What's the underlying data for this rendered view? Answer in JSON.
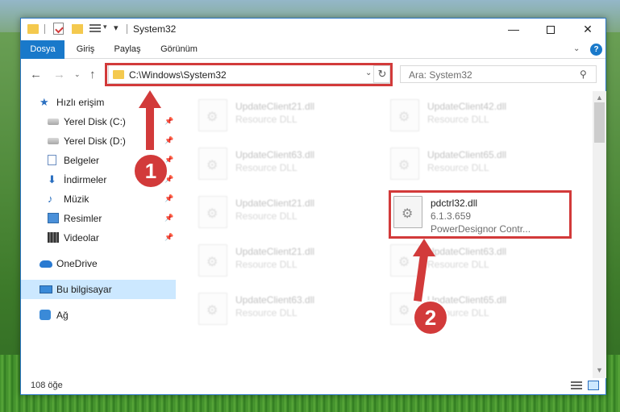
{
  "window": {
    "title": "System32",
    "minimize_glyph": "—",
    "close_glyph": "✕"
  },
  "ribbon": {
    "tabs": [
      "Dosya",
      "Giriş",
      "Paylaş",
      "Görünüm"
    ],
    "help": "?",
    "expand_glyph": "⌄"
  },
  "nav": {
    "back": "←",
    "forward": "→",
    "recent": "⌄",
    "up": "↑",
    "address": "C:\\Windows\\System32",
    "address_chevron": "⌄",
    "refresh": "↻",
    "search_placeholder": "Ara: System32",
    "search_glyph": "⚲"
  },
  "sidebar": {
    "items": [
      {
        "label": "Hızlı erişim",
        "icon": "star-icon",
        "glyph": "★"
      },
      {
        "label": "Yerel Disk (C:)",
        "icon": "disk-icon",
        "pinned": true
      },
      {
        "label": "Yerel Disk (D:)",
        "icon": "disk-icon",
        "pinned": true
      },
      {
        "label": "Belgeler",
        "icon": "document-icon",
        "pinned": true
      },
      {
        "label": "İndirmeler",
        "icon": "download-icon",
        "glyph": "⬇",
        "pinned": true
      },
      {
        "label": "Müzik",
        "icon": "music-icon",
        "glyph": "♪",
        "pinned": true
      },
      {
        "label": "Resimler",
        "icon": "picture-icon",
        "pinned": true
      },
      {
        "label": "Videolar",
        "icon": "video-icon",
        "pinned": true
      },
      {
        "label": "OneDrive",
        "icon": "cloud-icon"
      },
      {
        "label": "Bu bilgisayar",
        "icon": "computer-icon",
        "selected": true
      },
      {
        "label": "Ağ",
        "icon": "network-icon"
      }
    ],
    "pin_glyph": "📌"
  },
  "files": [
    {
      "name": "UpdateClient21.dll",
      "desc": "Resource DLL"
    },
    {
      "name": "UpdateClient42.dll",
      "desc": "Resource DLL"
    },
    {
      "name": "UpdateClient63.dll",
      "desc": "Resource DLL"
    },
    {
      "name": "UpdateClient65.dll",
      "desc": "Resource DLL"
    },
    {
      "name": "UpdateClient21.dll",
      "desc": "Resource DLL"
    },
    {
      "name": "pdctrl32.dll",
      "version": "6.1.3.659",
      "desc": "PowerDesignor Contr..."
    },
    {
      "name": "UpdateClient21.dll",
      "desc": "Resource DLL"
    },
    {
      "name": "UpdateClient63.dll",
      "desc": "Resource DLL"
    },
    {
      "name": "UpdateClient63.dll",
      "desc": "Resource DLL"
    },
    {
      "name": "UpdateClient65.dll",
      "desc": "Resource DLL"
    }
  ],
  "status": {
    "item_count": "108 öğe"
  },
  "annotations": {
    "badge1": "1",
    "badge2": "2",
    "color": "#d23a3a"
  },
  "colors": {
    "accent": "#1979ca",
    "selection": "#cce8ff"
  }
}
